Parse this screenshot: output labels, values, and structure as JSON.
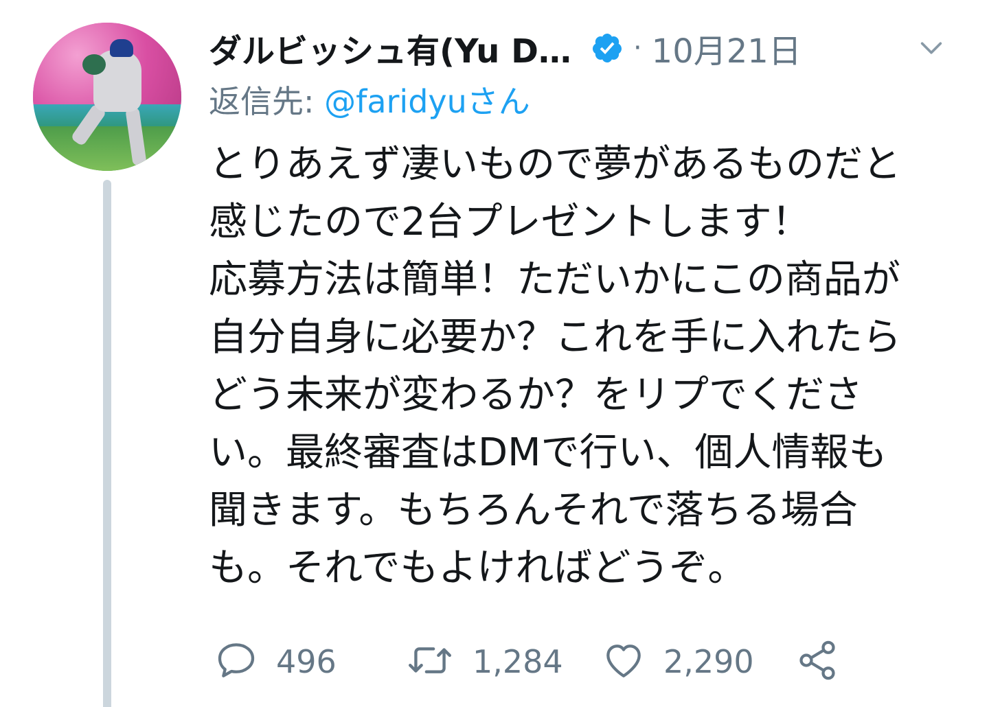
{
  "user": {
    "display_name": "ダルビッシュ有(Yu D…",
    "verified_icon": "verified-badge-icon",
    "separator": "·",
    "date": "10月21日"
  },
  "reply": {
    "prefix": "返信先: ",
    "mention": "@faridyuさん"
  },
  "tweet": {
    "lines": [
      "とりあえず凄いもので夢があるものだと",
      "感じたので2台プレゼントします！",
      "応募方法は簡単！ただいかにこの商品が",
      "自分自身に必要か？これを手に入れたら",
      "どう未来が変わるか？をリプでくださ",
      "い。最終審査はDMで行い、個人情報も",
      "聞きます。もちろんそれで落ちる場合",
      "も。それでもよければどうぞ。"
    ]
  },
  "actions": {
    "reply_count": "496",
    "retweet_count": "1,284",
    "like_count": "2,290"
  },
  "colors": {
    "text": "#14171a",
    "secondary": "#657786",
    "link": "#1da1f2",
    "verified": "#1da1f2",
    "thread_line": "#ccd6dd"
  }
}
